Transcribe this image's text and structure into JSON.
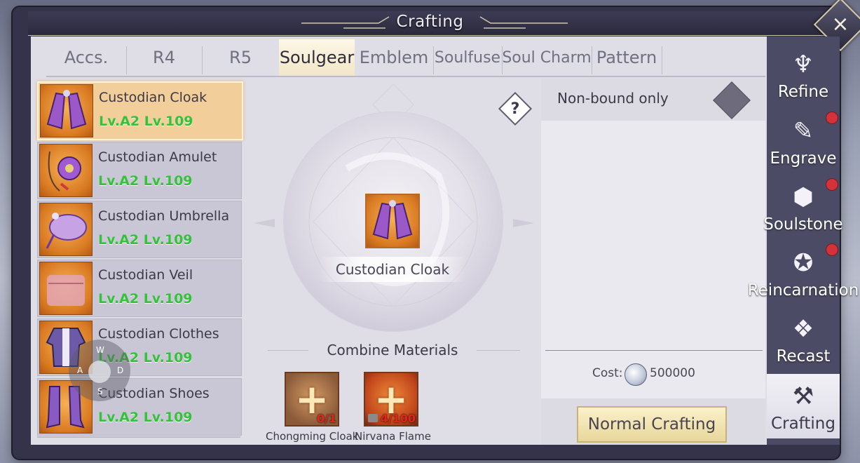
{
  "window": {
    "title": "Crafting",
    "close_icon": "×"
  },
  "tabs": [
    {
      "label": "Accs.",
      "active": false
    },
    {
      "label": "R4",
      "active": false
    },
    {
      "label": "R5",
      "active": false
    },
    {
      "label": "Soulgear",
      "active": true
    },
    {
      "label": "Emblem",
      "active": false
    },
    {
      "label": "Soulfuse",
      "active": false
    },
    {
      "label": "Soul Charm",
      "active": false
    },
    {
      "label": "Pattern",
      "active": false
    }
  ],
  "items": [
    {
      "name": "Custodian Cloak",
      "level": "Lv.A2 Lv.109",
      "icon": "cloak-icon",
      "selected": true
    },
    {
      "name": "Custodian Amulet",
      "level": "Lv.A2 Lv.109",
      "icon": "amulet-icon",
      "selected": false
    },
    {
      "name": "Custodian Umbrella",
      "level": "Lv.A2 Lv.109",
      "icon": "umbrella-icon",
      "selected": false
    },
    {
      "name": "Custodian Veil",
      "level": "Lv.A2 Lv.109",
      "icon": "veil-icon",
      "selected": false
    },
    {
      "name": "Custodian Clothes",
      "level": "Lv.A2 Lv.109",
      "icon": "clothes-icon",
      "selected": false
    },
    {
      "name": "Custodian Shoes",
      "level": "Lv.A2 Lv.109",
      "icon": "shoes-icon",
      "selected": false
    }
  ],
  "joystick": {
    "up": "W",
    "left": "A",
    "right": "D",
    "down": "S"
  },
  "craft": {
    "help_label": "?",
    "selected_name": "Custodian Cloak",
    "combine_label": "Combine Materials",
    "materials": [
      {
        "name": "Chongming Cloak",
        "count": "0/1",
        "locked": false
      },
      {
        "name": "Nirvana Flame",
        "count": "4/100",
        "locked": true
      }
    ]
  },
  "info": {
    "non_bound_label": "Non-bound only",
    "cost_label": "Cost:",
    "cost_value": "500000",
    "craft_button": "Normal Crafting"
  },
  "sidebar": [
    {
      "label": "Refine",
      "icon": "refine-icon",
      "glyph": "♆",
      "badge": false,
      "active": false
    },
    {
      "label": "Engrave",
      "icon": "engrave-icon",
      "glyph": "✎",
      "badge": true,
      "active": false
    },
    {
      "label": "Soulstone",
      "icon": "soulstone-icon",
      "glyph": "⬢",
      "badge": true,
      "active": false
    },
    {
      "label": "Reincarnation",
      "icon": "reincarnation-icon",
      "glyph": "✪",
      "badge": true,
      "active": false
    },
    {
      "label": "Recast",
      "icon": "recast-icon",
      "glyph": "❖",
      "badge": false,
      "active": false
    },
    {
      "label": "Crafting",
      "icon": "crafting-hammer-icon",
      "glyph": "⚒",
      "badge": false,
      "active": true
    }
  ],
  "colors": {
    "accent_selected": "#f2cf9a",
    "level_green": "#33c23a",
    "badge_red": "#d3323a",
    "count_red": "#e2261c"
  }
}
